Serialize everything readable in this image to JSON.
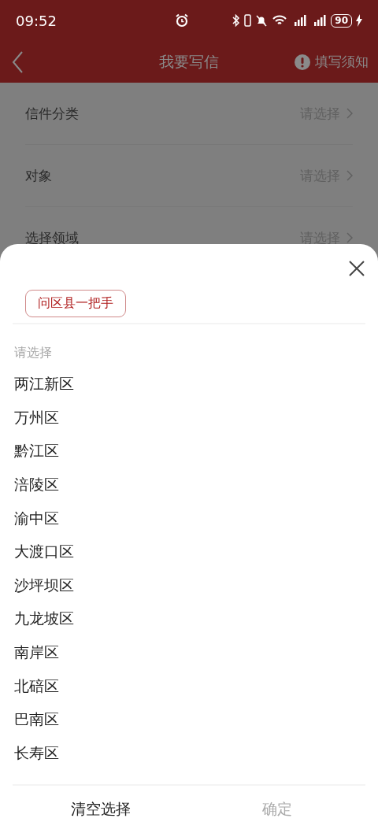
{
  "status_bar": {
    "time": "09:52",
    "battery": "90"
  },
  "header": {
    "title": "我要写信",
    "notice": "填写须知"
  },
  "form_rows": [
    {
      "label": "信件分类",
      "value": "请选择"
    },
    {
      "label": "对象",
      "value": "请选择"
    },
    {
      "label": "选择领域",
      "value": "请选择"
    }
  ],
  "sheet": {
    "tags": [
      {
        "label": "问区县一把手",
        "selected": true
      }
    ],
    "prompt": "请选择",
    "options": [
      "两江新区",
      "万州区",
      "黔江区",
      "涪陵区",
      "渝中区",
      "大渡口区",
      "沙坪坝区",
      "九龙坡区",
      "南岸区",
      "北碚区",
      "巴南区",
      "长寿区"
    ],
    "buttons": [
      {
        "label": "清空选择",
        "disabled": false
      },
      {
        "label": "确定",
        "disabled": true
      }
    ]
  }
}
